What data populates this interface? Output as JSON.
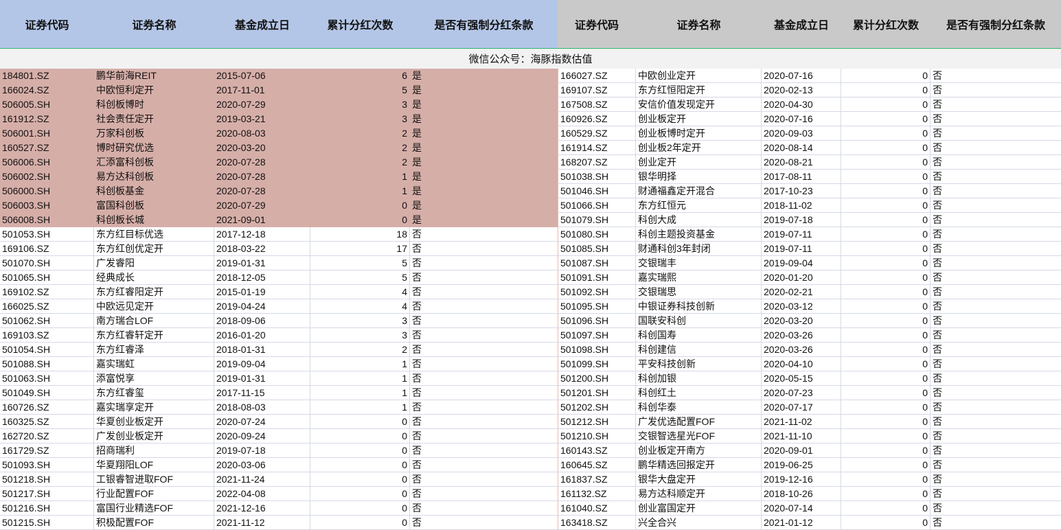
{
  "headers": [
    "证券代码",
    "证券名称",
    "基金成立日",
    "累计分红次数",
    "是否有强制分红条款"
  ],
  "banner": "微信公众号：海豚指数估值",
  "colors": {
    "left_header": "#b4c6e7",
    "right_header": "#c9c9c9",
    "highlight": "#d6aea8",
    "banner": "#f2f2f2"
  },
  "left_rows": [
    {
      "code": "184801.SZ",
      "name": "鹏华前海REIT",
      "date": "2015-07-06",
      "count": "6",
      "flag": "是",
      "highlight": true
    },
    {
      "code": "166024.SZ",
      "name": "中欧恒利定开",
      "date": "2017-11-01",
      "count": "5",
      "flag": "是",
      "highlight": true
    },
    {
      "code": "506005.SH",
      "name": "科创板博时",
      "date": "2020-07-29",
      "count": "3",
      "flag": "是",
      "highlight": true
    },
    {
      "code": "161912.SZ",
      "name": "社会责任定开",
      "date": "2019-03-21",
      "count": "3",
      "flag": "是",
      "highlight": true
    },
    {
      "code": "506001.SH",
      "name": "万家科创板",
      "date": "2020-08-03",
      "count": "2",
      "flag": "是",
      "highlight": true
    },
    {
      "code": "160527.SZ",
      "name": "博时研究优选",
      "date": "2020-03-20",
      "count": "2",
      "flag": "是",
      "highlight": true
    },
    {
      "code": "506006.SH",
      "name": "汇添富科创板",
      "date": "2020-07-28",
      "count": "2",
      "flag": "是",
      "highlight": true
    },
    {
      "code": "506002.SH",
      "name": "易方达科创板",
      "date": "2020-07-28",
      "count": "1",
      "flag": "是",
      "highlight": true
    },
    {
      "code": "506000.SH",
      "name": "科创板基金",
      "date": "2020-07-28",
      "count": "1",
      "flag": "是",
      "highlight": true
    },
    {
      "code": "506003.SH",
      "name": "富国科创板",
      "date": "2020-07-29",
      "count": "0",
      "flag": "是",
      "highlight": true
    },
    {
      "code": "506008.SH",
      "name": "科创板长城",
      "date": "2021-09-01",
      "count": "0",
      "flag": "是",
      "highlight": true
    },
    {
      "code": "501053.SH",
      "name": "东方红目标优选",
      "date": "2017-12-18",
      "count": "18",
      "flag": "否"
    },
    {
      "code": "169106.SZ",
      "name": "东方红创优定开",
      "date": "2018-03-22",
      "count": "17",
      "flag": "否"
    },
    {
      "code": "501070.SH",
      "name": "广发睿阳",
      "date": "2019-01-31",
      "count": "5",
      "flag": "否"
    },
    {
      "code": "501065.SH",
      "name": "经典成长",
      "date": "2018-12-05",
      "count": "5",
      "flag": "否"
    },
    {
      "code": "169102.SZ",
      "name": "东方红睿阳定开",
      "date": "2015-01-19",
      "count": "4",
      "flag": "否"
    },
    {
      "code": "166025.SZ",
      "name": "中欧远见定开",
      "date": "2019-04-24",
      "count": "4",
      "flag": "否"
    },
    {
      "code": "501062.SH",
      "name": "南方瑞合LOF",
      "date": "2018-09-06",
      "count": "3",
      "flag": "否"
    },
    {
      "code": "169103.SZ",
      "name": "东方红睿轩定开",
      "date": "2016-01-20",
      "count": "3",
      "flag": "否"
    },
    {
      "code": "501054.SH",
      "name": "东方红睿泽",
      "date": "2018-01-31",
      "count": "2",
      "flag": "否"
    },
    {
      "code": "501088.SH",
      "name": "嘉实瑞虹",
      "date": "2019-09-04",
      "count": "1",
      "flag": "否"
    },
    {
      "code": "501063.SH",
      "name": "添富悦享",
      "date": "2019-01-31",
      "count": "1",
      "flag": "否"
    },
    {
      "code": "501049.SH",
      "name": "东方红睿玺",
      "date": "2017-11-15",
      "count": "1",
      "flag": "否"
    },
    {
      "code": "160726.SZ",
      "name": "嘉实瑞享定开",
      "date": "2018-08-03",
      "count": "1",
      "flag": "否"
    },
    {
      "code": "160325.SZ",
      "name": "华夏创业板定开",
      "date": "2020-07-24",
      "count": "0",
      "flag": "否"
    },
    {
      "code": "162720.SZ",
      "name": "广发创业板定开",
      "date": "2020-09-24",
      "count": "0",
      "flag": "否"
    },
    {
      "code": "161729.SZ",
      "name": "招商瑞利",
      "date": "2019-07-18",
      "count": "0",
      "flag": "否"
    },
    {
      "code": "501093.SH",
      "name": "华夏翔阳LOF",
      "date": "2020-03-06",
      "count": "0",
      "flag": "否"
    },
    {
      "code": "501218.SH",
      "name": "工银睿智进取FOF",
      "date": "2021-11-24",
      "count": "0",
      "flag": "否"
    },
    {
      "code": "501217.SH",
      "name": "行业配置FOF",
      "date": "2022-04-08",
      "count": "0",
      "flag": "否"
    },
    {
      "code": "501216.SH",
      "name": "富国行业精选FOF",
      "date": "2021-12-16",
      "count": "0",
      "flag": "否"
    },
    {
      "code": "501215.SH",
      "name": "积极配置FOF",
      "date": "2021-11-12",
      "count": "0",
      "flag": "否"
    }
  ],
  "right_rows": [
    {
      "code": "166027.SZ",
      "name": "中欧创业定开",
      "date": "2020-07-16",
      "count": "0",
      "flag": "否"
    },
    {
      "code": "169107.SZ",
      "name": "东方红恒阳定开",
      "date": "2020-02-13",
      "count": "0",
      "flag": "否"
    },
    {
      "code": "167508.SZ",
      "name": "安信价值发现定开",
      "date": "2020-04-30",
      "count": "0",
      "flag": "否"
    },
    {
      "code": "160926.SZ",
      "name": "创业板定开",
      "date": "2020-07-16",
      "count": "0",
      "flag": "否"
    },
    {
      "code": "160529.SZ",
      "name": "创业板博时定开",
      "date": "2020-09-03",
      "count": "0",
      "flag": "否"
    },
    {
      "code": "161914.SZ",
      "name": "创业板2年定开",
      "date": "2020-08-14",
      "count": "0",
      "flag": "否"
    },
    {
      "code": "168207.SZ",
      "name": "创业定开",
      "date": "2020-08-21",
      "count": "0",
      "flag": "否"
    },
    {
      "code": "501038.SH",
      "name": "银华明择",
      "date": "2017-08-11",
      "count": "0",
      "flag": "否"
    },
    {
      "code": "501046.SH",
      "name": "财通福鑫定开混合",
      "date": "2017-10-23",
      "count": "0",
      "flag": "否"
    },
    {
      "code": "501066.SH",
      "name": "东方红恒元",
      "date": "2018-11-02",
      "count": "0",
      "flag": "否"
    },
    {
      "code": "501079.SH",
      "name": "科创大成",
      "date": "2019-07-18",
      "count": "0",
      "flag": "否"
    },
    {
      "code": "501080.SH",
      "name": "科创主题投资基金",
      "date": "2019-07-11",
      "count": "0",
      "flag": "否"
    },
    {
      "code": "501085.SH",
      "name": "财通科创3年封闭",
      "date": "2019-07-11",
      "count": "0",
      "flag": "否"
    },
    {
      "code": "501087.SH",
      "name": "交银瑞丰",
      "date": "2019-09-04",
      "count": "0",
      "flag": "否"
    },
    {
      "code": "501091.SH",
      "name": "嘉实瑞熙",
      "date": "2020-01-20",
      "count": "0",
      "flag": "否"
    },
    {
      "code": "501092.SH",
      "name": "交银瑞思",
      "date": "2020-02-21",
      "count": "0",
      "flag": "否"
    },
    {
      "code": "501095.SH",
      "name": "中银证券科技创新",
      "date": "2020-03-12",
      "count": "0",
      "flag": "否"
    },
    {
      "code": "501096.SH",
      "name": "国联安科创",
      "date": "2020-03-20",
      "count": "0",
      "flag": "否"
    },
    {
      "code": "501097.SH",
      "name": "科创国寿",
      "date": "2020-03-26",
      "count": "0",
      "flag": "否"
    },
    {
      "code": "501098.SH",
      "name": "科创建信",
      "date": "2020-03-26",
      "count": "0",
      "flag": "否"
    },
    {
      "code": "501099.SH",
      "name": "平安科技创新",
      "date": "2020-04-10",
      "count": "0",
      "flag": "否"
    },
    {
      "code": "501200.SH",
      "name": "科创加银",
      "date": "2020-05-15",
      "count": "0",
      "flag": "否"
    },
    {
      "code": "501201.SH",
      "name": "科创红土",
      "date": "2020-07-23",
      "count": "0",
      "flag": "否"
    },
    {
      "code": "501202.SH",
      "name": "科创华泰",
      "date": "2020-07-17",
      "count": "0",
      "flag": "否"
    },
    {
      "code": "501212.SH",
      "name": "广发优选配置FOF",
      "date": "2021-11-02",
      "count": "0",
      "flag": "否"
    },
    {
      "code": "501210.SH",
      "name": "交银智选星光FOF",
      "date": "2021-11-10",
      "count": "0",
      "flag": "否"
    },
    {
      "code": "160143.SZ",
      "name": "创业板定开南方",
      "date": "2020-09-01",
      "count": "0",
      "flag": "否"
    },
    {
      "code": "160645.SZ",
      "name": "鹏华精选回报定开",
      "date": "2019-06-25",
      "count": "0",
      "flag": "否"
    },
    {
      "code": "161837.SZ",
      "name": "银华大盘定开",
      "date": "2019-12-16",
      "count": "0",
      "flag": "否"
    },
    {
      "code": "161132.SZ",
      "name": "易方达科顺定开",
      "date": "2018-10-26",
      "count": "0",
      "flag": "否"
    },
    {
      "code": "161040.SZ",
      "name": "创业富国定开",
      "date": "2020-07-14",
      "count": "0",
      "flag": "否"
    },
    {
      "code": "163418.SZ",
      "name": "兴全合兴",
      "date": "2021-01-12",
      "count": "0",
      "flag": "否"
    }
  ]
}
